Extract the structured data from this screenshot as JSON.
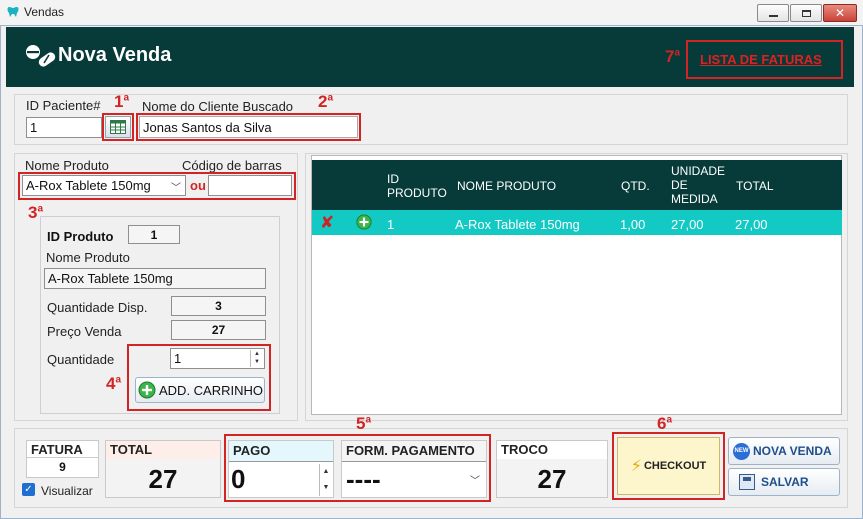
{
  "window": {
    "title": "Vendas"
  },
  "header": {
    "title": "Nova Venda",
    "link_lista": "LISTA DE FATURAS"
  },
  "annotations": {
    "a1": "1",
    "a2": "2",
    "a3": "3",
    "a4": "4",
    "a5": "5",
    "a6": "6",
    "a7": "7",
    "sup": "a"
  },
  "paciente": {
    "id_label": "ID Paciente#",
    "id_value": "1",
    "nome_label": "Nome do Cliente Buscado",
    "nome_value": "Jonas Santos da Silva"
  },
  "produto_busca": {
    "nome_label": "Nome Produto",
    "barras_label": "Código de barras",
    "selected": "A-Rox Tablete 150mg",
    "ou": "ou",
    "barras_value": ""
  },
  "produto_detalhe": {
    "id_label": "ID Produto",
    "id_value": "1",
    "nome_label": "Nome Produto",
    "nome_value": "A-Rox Tablete 150mg",
    "qtd_disp_label": "Quantidade Disp.",
    "qtd_disp_value": "3",
    "preco_label": "Preço Venda",
    "preco_value": "27",
    "quantidade_label": "Quantidade",
    "quantidade_value": "1",
    "add_button": "ADD. CARRINHO"
  },
  "grid": {
    "columns": [
      "ID PRODUTO",
      "NOME PRODUTO",
      "QTD.",
      "UNIDADE DE MEDIDA",
      "TOTAL"
    ],
    "rows": [
      {
        "id": "1",
        "nome": "A-Rox Tablete 150mg",
        "qtd": "1,00",
        "unidade": "27,00",
        "total": "27,00"
      }
    ]
  },
  "footer": {
    "fatura_label": "FATURA",
    "fatura_value": "9",
    "visualizar_label": "Visualizar",
    "total_label": "TOTAL",
    "total_value": "27",
    "pago_label": "PAGO",
    "pago_value": "0",
    "forma_label": "FORM. PAGAMENTO",
    "forma_value": "----",
    "troco_label": "TROCO",
    "troco_value": "27",
    "checkout_label": "CHECKOUT",
    "nova_venda_label": "NOVA VENDA",
    "salvar_label": "SALVAR"
  },
  "colors": {
    "header_bg": "#063b3a",
    "row_selected": "#13c9c4",
    "annotation_red": "#d32424",
    "link_red": "#e02020"
  }
}
